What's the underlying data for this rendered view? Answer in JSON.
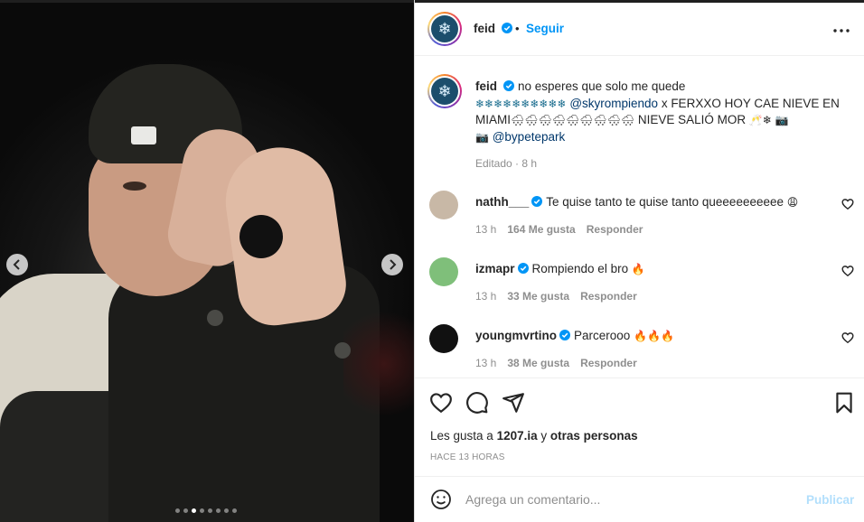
{
  "post": {
    "username": "feid",
    "follow_label": "Seguir",
    "dot": "•",
    "avatar_glyph": "❄",
    "media": {
      "current_slide": 3,
      "total_slides": 8
    }
  },
  "caption": {
    "username": "feid",
    "text_a": "no esperes que solo me quede",
    "snowflakes": "❄❄❄❄❄❄❄❄❄❄",
    "mention_1": "@skyrompiendo",
    "text_b": " x FERXXO HOY CAE NIEVE EN MIAMI",
    "snow_clouds": "🌨🌨🌨🌨🌨🌨🌨🌨🌨",
    "text_c": " NIEVE SALIÓ MOR ",
    "text_d": "🥂❄ 📷",
    "camera": "📷",
    "mention_2": "@bypetepark",
    "meta": "Editado · 8 h"
  },
  "comments": [
    {
      "username": "nathh___",
      "text": "Te quise tanto te quise tanto queeeeeeeeee",
      "emoji": "😩",
      "time": "13 h",
      "likes": "164 Me gusta",
      "reply": "Responder",
      "avatar_color": "#c8b8a6"
    },
    {
      "username": "izmapr",
      "text": "Rompiendo el bro",
      "emoji": "🔥",
      "time": "13 h",
      "likes": "33 Me gusta",
      "reply": "Responder",
      "avatar_color": "#7fbf7a"
    },
    {
      "username": "youngmvrtino",
      "text": "Parcerooo",
      "emoji": "🔥🔥🔥",
      "time": "13 h",
      "likes": "38 Me gusta",
      "reply": "Responder",
      "avatar_color": "#111111"
    }
  ],
  "likes": {
    "prefix": "Les gusta a ",
    "user": "1207.ia",
    "middle": " y ",
    "others": "otras personas"
  },
  "timestamp": "HACE 13 HORAS",
  "add_comment": {
    "placeholder": "Agrega un comentario...",
    "post_label": "Publicar"
  },
  "colors": {
    "link": "#0095f6",
    "mention": "#00376b",
    "muted": "#8e8e8e",
    "verified": "#0095f6"
  }
}
